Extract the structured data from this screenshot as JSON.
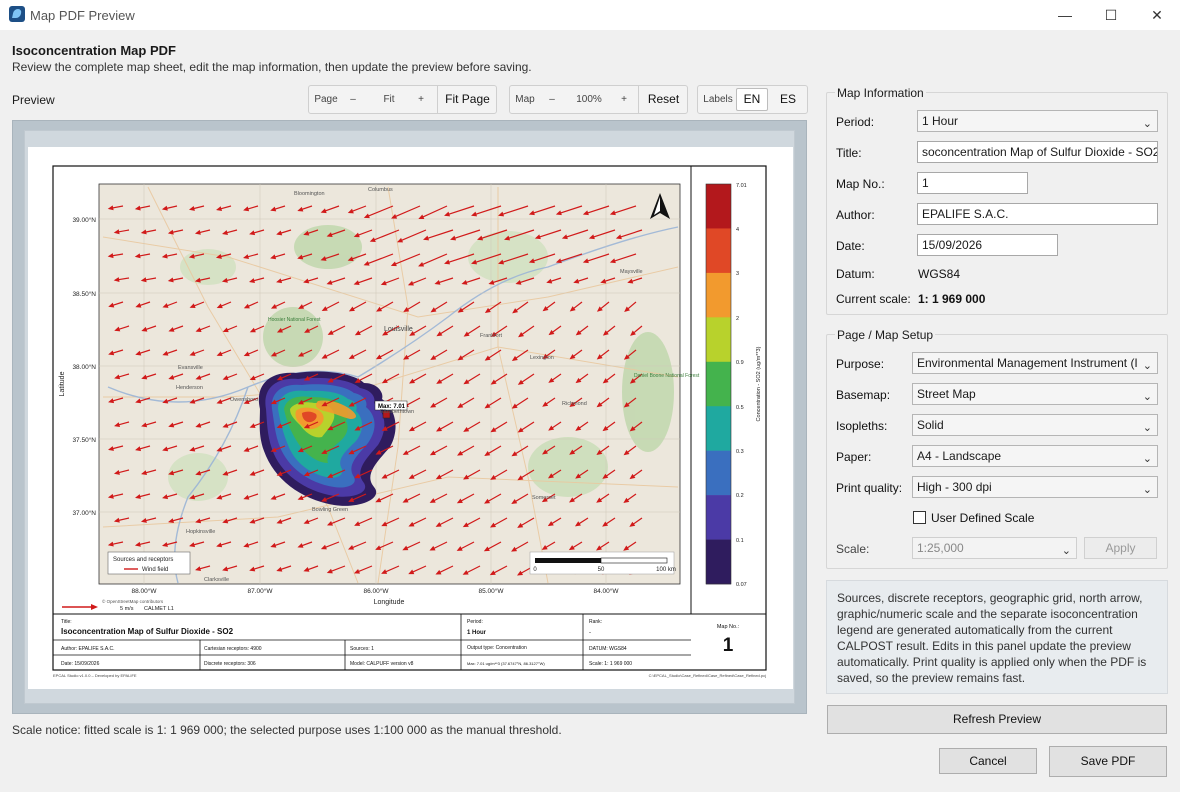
{
  "window": {
    "title": "Map PDF Preview",
    "minimize": "—",
    "maximize": "☐",
    "close": "✕"
  },
  "header": {
    "title": "Isoconcentration Map PDF",
    "subtitle": "Review the complete map sheet, edit the map information, then update the preview before saving."
  },
  "preview": {
    "label": "Preview",
    "scale_notice": "Scale notice: fitted scale is 1: 1 969 000; the selected purpose uses 1:100 000 as the manual threshold."
  },
  "toolbar": {
    "page_label": "Page",
    "page_minus": "–",
    "page_fit": "Fit",
    "page_plus": "+",
    "fit_page": "Fit Page",
    "map_label": "Map",
    "map_minus": "–",
    "map_zoom": "100%",
    "map_plus": "+",
    "reset": "Reset",
    "labels_label": "Labels",
    "lang_en": "EN",
    "lang_es": "ES"
  },
  "map_sheet": {
    "lat_ticks": [
      "39.00°N",
      "38.50°N",
      "38.00°N",
      "37.50°N",
      "37.00°N"
    ],
    "lon_ticks": [
      "88.00°W",
      "87.00°W",
      "86.00°W",
      "85.00°W",
      "84.00°W"
    ],
    "x_axis_label": "Longitude",
    "y_axis_label": "Latitude",
    "colorbar_ticks": [
      "7.01",
      "4",
      "3",
      "2",
      "0.9",
      "0.5",
      "0.3",
      "0.2",
      "0.1",
      "0.07"
    ],
    "colorbar_colors": [
      "#b3181c",
      "#e04826",
      "#f29a2e",
      "#b8d22c",
      "#44b34d",
      "#1fa9a0",
      "#3a6fbf",
      "#4b3aa6",
      "#2f1c5e"
    ],
    "colorbar_label": "Concentration - SO2 (ug/m**3)",
    "max_label": "Max: 7.01",
    "places": [
      "Bloomington",
      "Columbus",
      "Evansville",
      "Henderson",
      "Owensboro",
      "Louisville",
      "Elizabethtown",
      "Frankfort",
      "Lexington",
      "Richmond",
      "Maysville",
      "Daniel Boone National Forest",
      "Hoosier National Forest",
      "Bowling Green",
      "Hopkinsville",
      "Clarksville",
      "Somerset"
    ],
    "legend_title": "Sources and receptors",
    "legend_item": "Wind field",
    "scalebar_labels": [
      "0",
      "50",
      "100 km"
    ],
    "osm_credit": "© OpenStreetMap contributors",
    "wind_ref_speed": "5 m/s",
    "wind_ref_label": "CALMET L1",
    "titleblock": {
      "title_caption": "Title:",
      "title_value": "Isoconcentration Map of Sulfur Dioxide - SO2",
      "period_caption": "Period:",
      "period_value": "1 Hour",
      "rank_caption": "Rank:",
      "rank_value": "-",
      "mapno_caption": "Map No.:",
      "mapno_value": "1",
      "author": "Author:   EPALIFE S.A.C.",
      "date": "Date:   15/09/2026",
      "cart_receptors": "Cartesian receptors:  4900",
      "discrete_receptors": "Discrete receptors:  306",
      "sources": "Sources:  1",
      "model": "Model:  CALPUFF version v8",
      "output_type": "Output type:  Concentration",
      "max": "Max:  7.01 ug/m**3 (37.6747°N, 86.3127°W)",
      "datum": "DATUM:  WGS84",
      "scale": "Scale:  1: 1 969 000"
    },
    "footer_left": "EPCAL Studio v1.0.0 – Developed by EPALIFE",
    "footer_right": "C:\\EPCAL_Studio\\Case_Refined\\Case_Refined\\Case_Refined.pcj"
  },
  "map_information": {
    "legend": "Map Information",
    "period_label": "Period:",
    "period_value": "1 Hour",
    "title_label": "Title:",
    "title_value": "soconcentration Map of Sulfur Dioxide - SO2",
    "mapno_label": "Map No.:",
    "mapno_value": "1",
    "author_label": "Author:",
    "author_value": "EPALIFE S.A.C.",
    "date_label": "Date:",
    "date_value": "15/09/2026",
    "datum_label": "Datum:",
    "datum_value": "WGS84",
    "scale_label": "Current scale:",
    "scale_value": "1: 1 969 000"
  },
  "page_setup": {
    "legend": "Page / Map Setup",
    "purpose_label": "Purpose:",
    "purpose_value": "Environmental Management Instrument (I",
    "basemap_label": "Basemap:",
    "basemap_value": "Street Map",
    "isopleths_label": "Isopleths:",
    "isopleths_value": "Solid",
    "paper_label": "Paper:",
    "paper_value": "A4 - Landscape",
    "quality_label": "Print quality:",
    "quality_value": "High - 300 dpi",
    "user_scale_label": "User Defined Scale",
    "scale_label": "Scale:",
    "scale_value": "1:25,000",
    "apply": "Apply"
  },
  "info_text": "Sources, discrete receptors, geographic grid, north arrow, graphic/numeric scale and the separate isoconcentration legend are generated automatically from the current CALPOST result. Edits in this panel update the preview automatically. Print quality is applied only when the PDF is saved, so the preview remains fast.",
  "buttons": {
    "refresh": "Refresh Preview",
    "cancel": "Cancel",
    "save": "Save PDF"
  }
}
